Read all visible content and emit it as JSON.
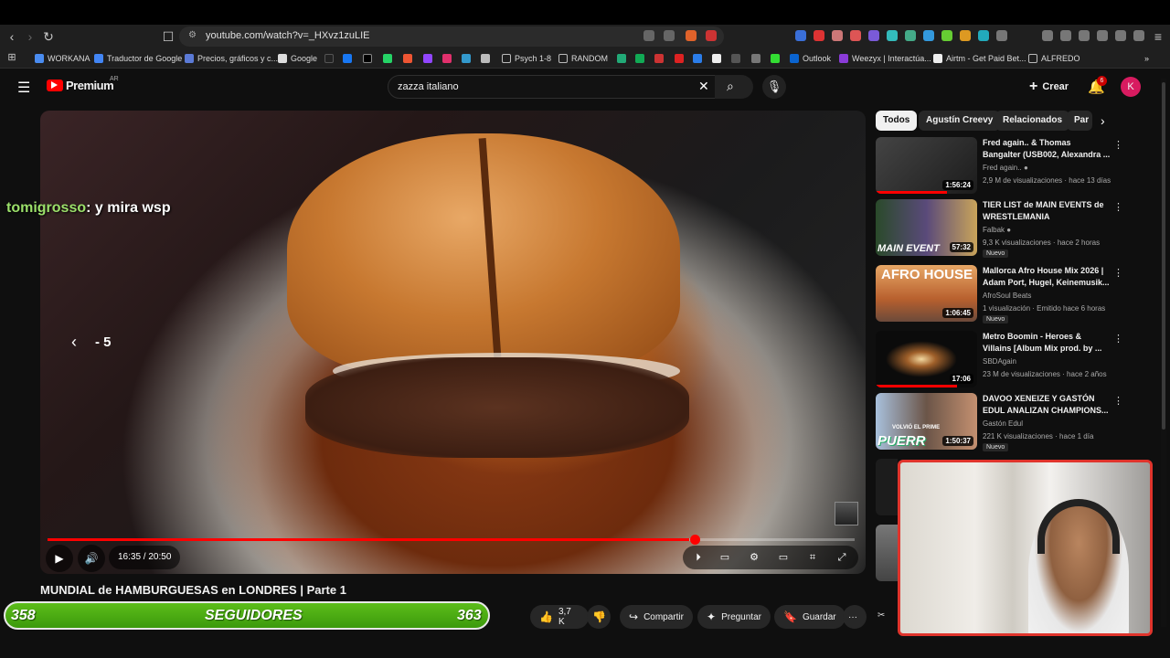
{
  "browser": {
    "url": "youtube.com/watch?v=_HXvz1zuLIE",
    "bookmarks": [
      "WORKANA",
      "Traductor de Google",
      "Precios, gráficos y c...",
      "Google",
      "Psych 1-8",
      "RANDOM",
      "Outlook",
      "Weezyx | Interactúa...",
      "Airtm - Get Paid Bet...",
      "ALFREDO"
    ]
  },
  "youtube": {
    "logo": "Premium",
    "region": "AR",
    "search_value": "zazza italiano",
    "create_label": "Crear",
    "notifications_count": "6",
    "avatar_letter": "K"
  },
  "video": {
    "chat_user": "tomigrosso",
    "chat_message": ": y mira wsp",
    "seek_hint": "- 5",
    "time": "16:35 / 20:50",
    "progress": 0.795,
    "title": "MUNDIAL de HAMBURGUESAS en LONDRES | Parte 1"
  },
  "followers": {
    "current": "358",
    "label": "SEGUIDORES",
    "goal": "363"
  },
  "actions": {
    "likes": "3,7 K",
    "share": "Compartir",
    "ask": "Preguntar",
    "save": "Guardar",
    "more": "···"
  },
  "chips": [
    "Todos",
    "Agustín Creevy",
    "Relacionados",
    "Par"
  ],
  "recommendations": [
    {
      "title": "Fred again.. & Thomas Bangalter (USB002, Alexandra ...",
      "channel": "Fred again..",
      "meta": "2,9 M de visualizaciones · hace 13 días",
      "duration": "1:56:24",
      "badge": "",
      "watched": 0.7,
      "thumb": "#2b2b2b"
    },
    {
      "title": "TIER LIST de MAIN EVENTS de WRESTLEMANIA",
      "channel": "Falbak",
      "meta": "9,3 K visualizaciones · hace 2 horas",
      "duration": "57:32",
      "badge": "Nuevo",
      "watched": 0,
      "thumb": "#3a3f55"
    },
    {
      "title": "Mallorca Afro House Mix 2026 | Adam Port, Hugel, Keinemusik...",
      "channel": "AfroSoul Beats",
      "meta": "1 visualización · Emitido hace 6 horas",
      "duration": "1:06:45",
      "badge": "Nuevo",
      "watched": 0,
      "thumb": "#d48a4a"
    },
    {
      "title": "Metro Boomin - Heroes & Villains [Album Mix prod. by ...",
      "channel": "SBDAgain",
      "meta": "23 M de visualizaciones · hace 2 años",
      "duration": "17:06",
      "badge": "",
      "watched": 0.8,
      "thumb": "#111111"
    },
    {
      "title": "DAVOO XENEIZE Y GASTÓN EDUL ANALIZAN CHAMPIONS...",
      "channel": "Gastón Edul",
      "meta": "221 K visualizaciones · hace 1 día",
      "duration": "1:50:37",
      "badge": "Nuevo",
      "watched": 0,
      "thumb": "#5a3e30"
    }
  ],
  "main_event_overlay": "MAIN EVENT",
  "afro_overlay": "AFRO HOUSE",
  "puerr_overlay": "PUERR",
  "volvio_overlay": "VOLVIÓ EL PRIME"
}
